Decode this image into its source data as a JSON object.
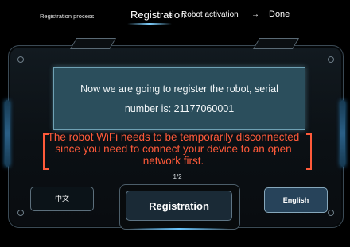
{
  "header": {
    "process_label": "Registration process:",
    "steps": [
      {
        "label": "Registration",
        "active": true
      },
      {
        "label": "Robot activation",
        "active": false
      },
      {
        "label": "Done",
        "active": false
      }
    ],
    "arrow": "→"
  },
  "message": {
    "line1": "Now we are going to register the robot, serial",
    "line2": "number is: 21177060001"
  },
  "warning": {
    "text": "The robot WiFi needs to be temporarily disconnected since you need to connect your device to an open network first."
  },
  "pagination": "1/2",
  "buttons": {
    "chinese": "中文",
    "register": "Registration",
    "english": "English"
  },
  "colors": {
    "panel": "#2b4e5c",
    "warning": "#ff5a3a",
    "accent": "#6bc6ff"
  }
}
